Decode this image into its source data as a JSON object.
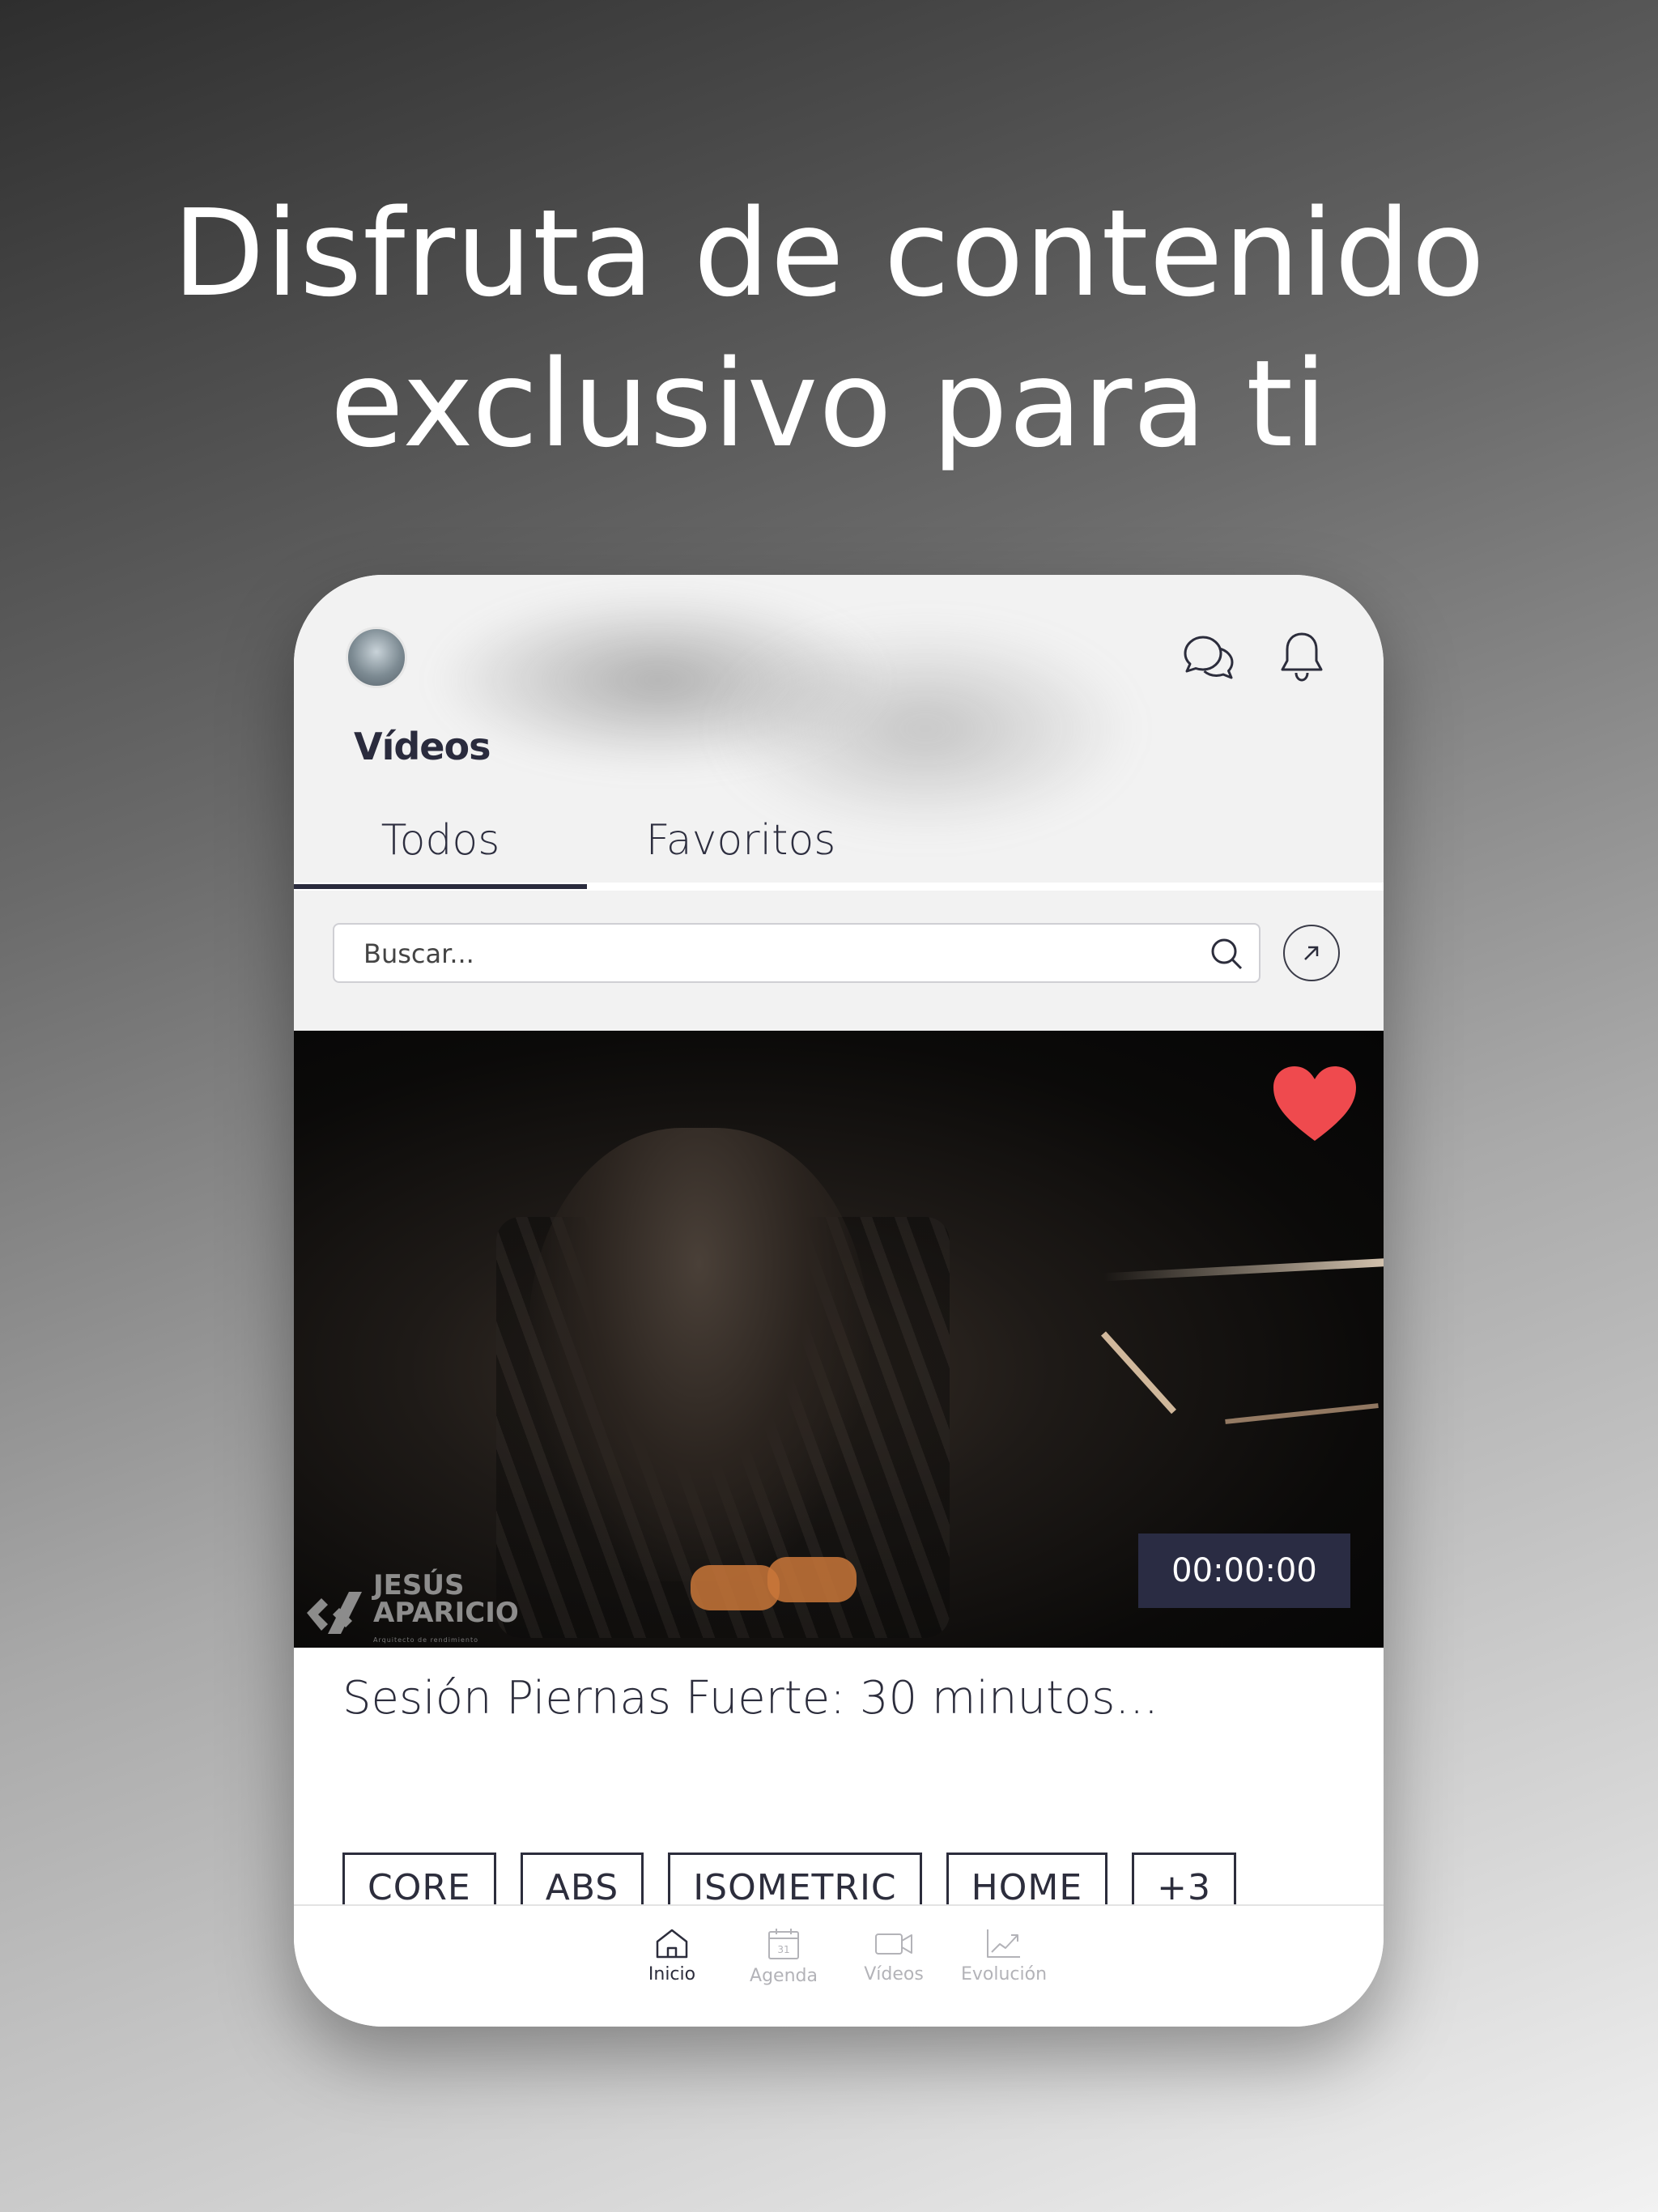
{
  "headline": {
    "line1": "Disfruta de contenido",
    "line2": "exclusivo para ti"
  },
  "header": {
    "title": "Vídeos"
  },
  "tabs": [
    {
      "label": "Todos",
      "active": true
    },
    {
      "label": "Favoritos",
      "active": false
    }
  ],
  "search": {
    "placeholder": "Buscar..."
  },
  "video": {
    "duration": "00:00:00",
    "favorited": true,
    "title": "Sesión Piernas Fuerte: 30 minutos...",
    "watermark": {
      "name_line1": "JESÚS",
      "name_line2": "APARICIO",
      "tagline": "Arquitecto de rendimiento"
    },
    "tags": [
      "CORE",
      "ABS",
      "ISOMETRIC",
      "HOME",
      "+3"
    ]
  },
  "nav": [
    {
      "label": "Inicio",
      "icon": "home-icon",
      "active": true
    },
    {
      "label": "Agenda",
      "icon": "calendar-icon",
      "active": false,
      "day": "31"
    },
    {
      "label": "Vídeos",
      "icon": "video-camera-icon",
      "active": false
    },
    {
      "label": "Evolución",
      "icon": "trend-chart-icon",
      "active": false
    }
  ],
  "colors": {
    "accent": "#2a2c43",
    "heart": "#ef4a4e",
    "text": "#2c2d3c",
    "inactive": "#b3b3b8"
  }
}
